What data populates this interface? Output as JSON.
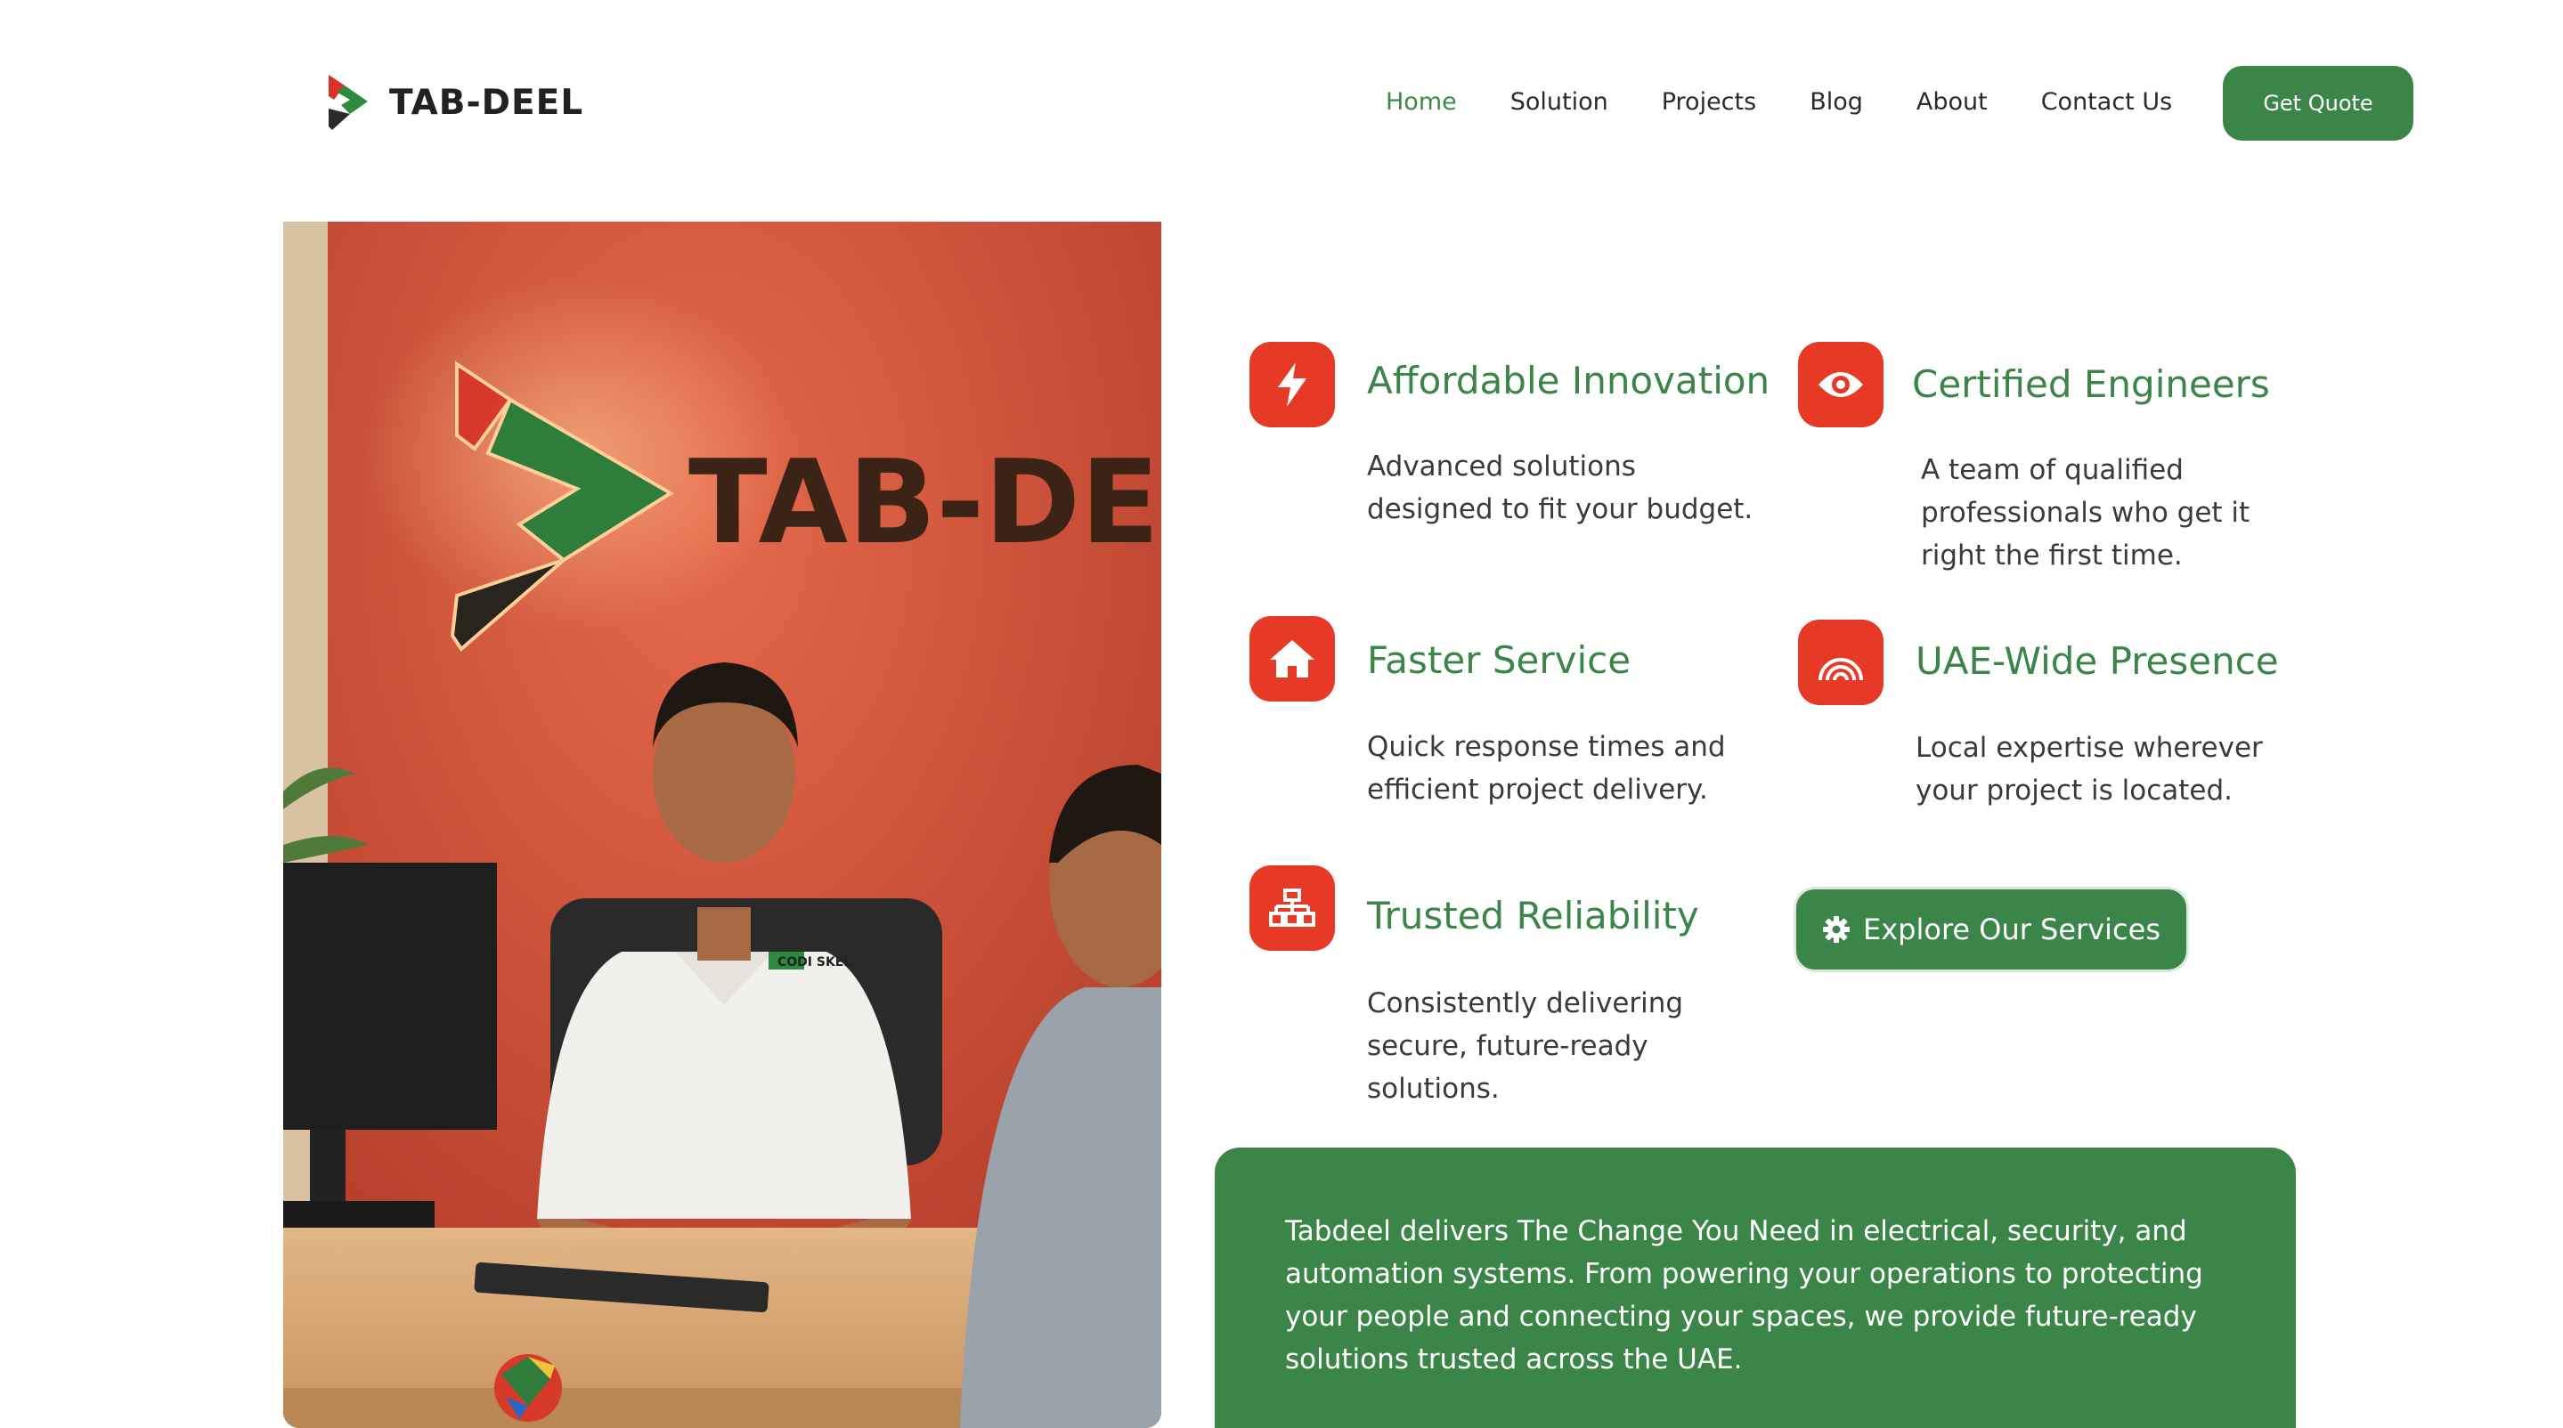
{
  "brand": {
    "name": "TAB-DEEL"
  },
  "nav": {
    "items": [
      {
        "label": "Home",
        "active": true
      },
      {
        "label": "Solution"
      },
      {
        "label": "Projects"
      },
      {
        "label": "Blog"
      },
      {
        "label": "About"
      },
      {
        "label": "Contact Us"
      }
    ],
    "cta": "Get Quote"
  },
  "photo": {
    "sign_text": "TAB-DEEL",
    "shirt_text": "CODI SKEL"
  },
  "features": [
    {
      "icon": "bolt-icon",
      "title": "Affordable Innovation",
      "desc": "Advanced solutions designed to fit your budget."
    },
    {
      "icon": "eye-icon",
      "title": "Certified Engineers",
      "desc": "A team of qualified professionals who get it right the first time."
    },
    {
      "icon": "home-icon",
      "title": "Faster Service",
      "desc": "Quick response times and efficient project delivery."
    },
    {
      "icon": "signal-arcs-icon",
      "title": "UAE-Wide Presence",
      "desc": "Local expertise wherever your project is located."
    },
    {
      "icon": "network-icon",
      "title": "Trusted Reliability",
      "desc": "Consistently delivering secure, future-ready solutions."
    }
  ],
  "explore_button": "Explore Our Services",
  "summary": "Tabdeel delivers The Change You Need in electrical, security, and automation systems. From powering your operations to protecting your people and connecting your spaces, we provide future-ready solutions trusted across the UAE.",
  "colors": {
    "accent_green": "#3b8548",
    "icon_red": "#e63a26"
  }
}
